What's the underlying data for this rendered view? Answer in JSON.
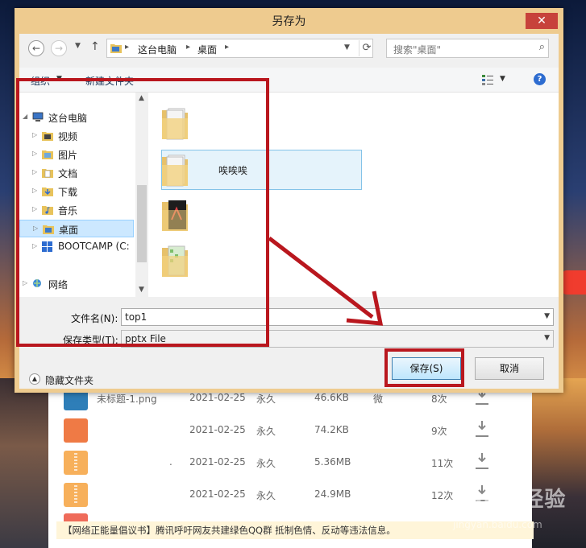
{
  "dialog": {
    "title": "另存为",
    "close_glyph": "✕",
    "address": {
      "crumbs": [
        "这台电脑",
        "桌面"
      ],
      "search_placeholder": "搜索\"桌面\""
    },
    "toolbar": {
      "organize": "组织",
      "new_folder": "新建文件夹"
    },
    "nav": [
      {
        "label": "这台电脑",
        "icon": "computer-icon",
        "level": 0,
        "expanded": true
      },
      {
        "label": "视频",
        "icon": "videos-folder-icon",
        "level": 1
      },
      {
        "label": "图片",
        "icon": "pictures-folder-icon",
        "level": 1
      },
      {
        "label": "文档",
        "icon": "documents-folder-icon",
        "level": 1
      },
      {
        "label": "下载",
        "icon": "downloads-folder-icon",
        "level": 1
      },
      {
        "label": "音乐",
        "icon": "music-folder-icon",
        "level": 1
      },
      {
        "label": "桌面",
        "icon": "desktop-folder-icon",
        "level": 1,
        "selected": true
      },
      {
        "label": "BOOTCAMP (C:",
        "icon": "drive-icon",
        "level": 1
      },
      {
        "label": "网络",
        "icon": "network-icon",
        "level": 0
      }
    ],
    "files": [
      {
        "label": "",
        "icon": "folder-icon"
      },
      {
        "label": "唉唉唉",
        "icon": "folder-icon",
        "selected": true
      },
      {
        "label": "",
        "icon": "folder-icon"
      },
      {
        "label": "",
        "icon": "folder-icon"
      }
    ],
    "filename_label": "文件名(N):",
    "filename_value": "top1",
    "filetype_label": "保存类型(T):",
    "filetype_value": "pptx File",
    "hide_folders": "隐藏文件夹",
    "save_button": "保存(S)",
    "cancel_button": "取消"
  },
  "background_list": {
    "rows": [
      {
        "name": "未标题-1.png",
        "date": "2021-02-25",
        "expire": "永久",
        "size": "46.6KB",
        "extra": "微",
        "count": "8次",
        "color": "#2e7eb8",
        "zip": false
      },
      {
        "name": "",
        "date": "2021-02-25",
        "expire": "永久",
        "size": "74.2KB",
        "extra": "",
        "count": "9次",
        "color": "#ef7a45",
        "zip": false
      },
      {
        "name": ".",
        "date": "2021-02-25",
        "expire": "永久",
        "size": "5.36MB",
        "extra": "",
        "count": "11次",
        "color": "#f7b05b",
        "zip": true
      },
      {
        "name": "",
        "date": "2021-02-25",
        "expire": "永久",
        "size": "24.9MB",
        "extra": "",
        "count": "12次",
        "color": "#f7b05b",
        "zip": true
      }
    ],
    "notice": "【网络正能量倡议书】腾讯呼吁网友共建绿色QQ群 抵制色情、反动等违法信息。",
    "watermark": "Baidu经验",
    "watermark_url": "jingyan.baidu.com"
  }
}
